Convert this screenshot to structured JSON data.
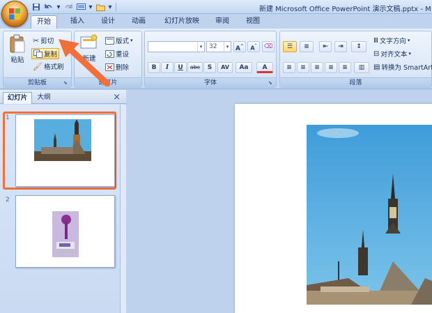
{
  "window": {
    "title": "新建 Microsoft Office PowerPoint 演示文稿.pptx - M"
  },
  "ribbon_tabs": [
    {
      "label": "开始",
      "active": true
    },
    {
      "label": "插入",
      "active": false
    },
    {
      "label": "设计",
      "active": false
    },
    {
      "label": "动画",
      "active": false
    },
    {
      "label": "幻灯片放映",
      "active": false
    },
    {
      "label": "审阅",
      "active": false
    },
    {
      "label": "视图",
      "active": false
    }
  ],
  "clipboard": {
    "group_label": "剪贴板",
    "paste_label": "粘贴",
    "cut_label": "剪切",
    "copy_label": "复制",
    "format_painter_label": "格式刷"
  },
  "slides_group": {
    "group_label": "幻灯片",
    "new_slide_label": "新建",
    "layout_label": "版式",
    "reset_label": "重设",
    "delete_label": "删除"
  },
  "font_group": {
    "group_label": "字体",
    "font_name_value": "",
    "font_size_value": "32",
    "bold": "B",
    "italic": "I",
    "underline": "U",
    "strike": "abc",
    "shadow": "S",
    "spacing": "AV",
    "case": "Aa",
    "grow": "A",
    "shrink": "A"
  },
  "paragraph_group": {
    "group_label": "段落",
    "text_direction_label": "文字方向",
    "align_text_label": "对齐文本",
    "convert_smartart_label": "转换为 SmartArt"
  },
  "left_pane": {
    "tab_slides": "幻灯片",
    "tab_outline": "大纲",
    "close_glyph": "×",
    "slides": [
      {
        "number": "1",
        "selected": true
      },
      {
        "number": "2",
        "selected": false
      }
    ]
  },
  "colors": {
    "highlight": "#f0703a",
    "ribbon": "#dbe7f7",
    "sky": "#4fa6d8"
  },
  "icons": [
    "office-button-icon",
    "save-icon",
    "undo-icon",
    "redo-icon",
    "paste-icon",
    "scissors-icon",
    "copy-icon",
    "brush-icon",
    "new-slide-icon",
    "layout-icon",
    "reset-icon",
    "delete-icon",
    "bullets-icon",
    "numbering-icon",
    "close-icon"
  ]
}
